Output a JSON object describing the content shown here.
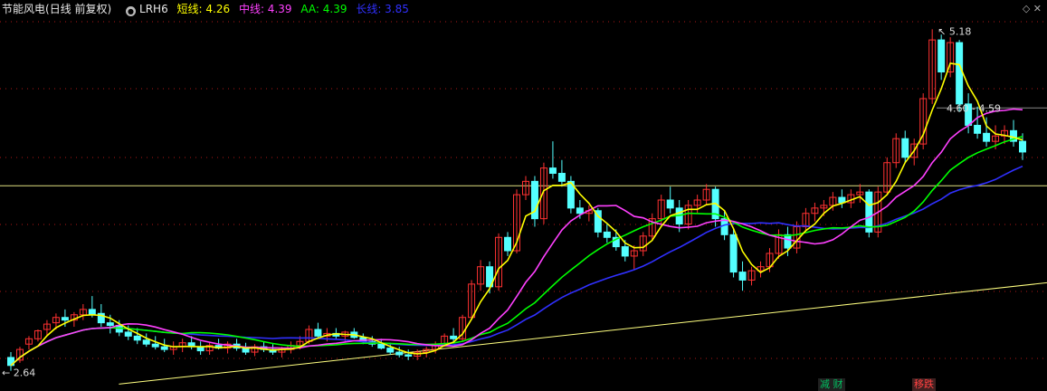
{
  "header": {
    "stock_name": "节能风电",
    "period_label": "(日线 前复权)",
    "indicator_name": "LRH6",
    "indicators": [
      {
        "label": "短线: 4.26",
        "color": "#ffff00"
      },
      {
        "label": "中线: 4.39",
        "color": "#ff40ff"
      },
      {
        "label": "AA: 4.39",
        "color": "#00ff00"
      },
      {
        "label": "长线: 3.85",
        "color": "#3030ff"
      }
    ],
    "corner_icons": [
      "diamond-icon",
      "close-icon"
    ]
  },
  "annotations": {
    "high_label": "5.18",
    "low_label": "2.64",
    "line_label": "4.60 - 4.59"
  },
  "signals": [
    {
      "label": "减 财",
      "color": "#00c060"
    },
    {
      "label": "移跌",
      "color": "#ff4040"
    }
  ],
  "chart_data": {
    "type": "candlestick",
    "ylim": [
      2.55,
      5.25
    ],
    "n_bars": 113,
    "colors": {
      "up": "#ff3232",
      "down": "#54ffff",
      "ma_short": "#ffff00",
      "ma_mid": "#ff40ff",
      "aa": "#00ff00",
      "ma_long": "#3030ff",
      "ref_line": "#ffff80",
      "grid": "#b01818"
    },
    "candles": [
      [
        2.72,
        2.76,
        2.62,
        2.66
      ],
      [
        2.7,
        2.8,
        2.68,
        2.78
      ],
      [
        2.82,
        2.88,
        2.78,
        2.86
      ],
      [
        2.86,
        2.93,
        2.84,
        2.92
      ],
      [
        2.93,
        3.0,
        2.88,
        2.97
      ],
      [
        2.98,
        3.05,
        2.93,
        3.02
      ],
      [
        3.02,
        3.08,
        2.95,
        3.0
      ],
      [
        3.0,
        3.06,
        2.95,
        3.04
      ],
      [
        3.04,
        3.12,
        3.0,
        3.08
      ],
      [
        3.08,
        3.18,
        3.02,
        3.04
      ],
      [
        3.05,
        3.12,
        2.95,
        2.98
      ],
      [
        2.98,
        3.04,
        2.9,
        2.96
      ],
      [
        2.96,
        3.0,
        2.88,
        2.91
      ],
      [
        2.91,
        2.96,
        2.85,
        2.88
      ],
      [
        2.88,
        2.94,
        2.82,
        2.85
      ],
      [
        2.85,
        2.9,
        2.8,
        2.82
      ],
      [
        2.82,
        2.88,
        2.78,
        2.8
      ],
      [
        2.8,
        2.86,
        2.76,
        2.78
      ],
      [
        2.78,
        2.84,
        2.74,
        2.8
      ],
      [
        2.8,
        2.86,
        2.76,
        2.83
      ],
      [
        2.83,
        2.88,
        2.78,
        2.8
      ],
      [
        2.8,
        2.84,
        2.74,
        2.77
      ],
      [
        2.77,
        2.83,
        2.74,
        2.81
      ],
      [
        2.81,
        2.86,
        2.78,
        2.79
      ],
      [
        2.79,
        2.84,
        2.75,
        2.82
      ],
      [
        2.82,
        2.86,
        2.77,
        2.79
      ],
      [
        2.79,
        2.83,
        2.74,
        2.76
      ],
      [
        2.76,
        2.82,
        2.73,
        2.8
      ],
      [
        2.8,
        2.84,
        2.76,
        2.78
      ],
      [
        2.78,
        2.82,
        2.74,
        2.76
      ],
      [
        2.76,
        2.8,
        2.72,
        2.78
      ],
      [
        2.78,
        2.84,
        2.75,
        2.81
      ],
      [
        2.81,
        2.88,
        2.78,
        2.84
      ],
      [
        2.84,
        2.96,
        2.82,
        2.93
      ],
      [
        2.93,
        2.98,
        2.86,
        2.88
      ],
      [
        2.88,
        2.94,
        2.84,
        2.9
      ],
      [
        2.9,
        2.94,
        2.86,
        2.88
      ],
      [
        2.88,
        2.92,
        2.84,
        2.91
      ],
      [
        2.91,
        2.94,
        2.86,
        2.87
      ],
      [
        2.87,
        2.9,
        2.82,
        2.84
      ],
      [
        2.84,
        2.88,
        2.8,
        2.82
      ],
      [
        2.82,
        2.86,
        2.78,
        2.79
      ],
      [
        2.79,
        2.83,
        2.74,
        2.76
      ],
      [
        2.76,
        2.8,
        2.72,
        2.74
      ],
      [
        2.74,
        2.78,
        2.7,
        2.73
      ],
      [
        2.73,
        2.78,
        2.7,
        2.76
      ],
      [
        2.76,
        2.8,
        2.72,
        2.78
      ],
      [
        2.78,
        2.84,
        2.75,
        2.82
      ],
      [
        2.82,
        2.9,
        2.8,
        2.88
      ],
      [
        2.88,
        2.94,
        2.84,
        2.86
      ],
      [
        2.86,
        3.04,
        2.84,
        3.02
      ],
      [
        3.02,
        3.3,
        3.0,
        3.27
      ],
      [
        3.27,
        3.45,
        3.22,
        3.4
      ],
      [
        3.4,
        3.44,
        3.2,
        3.25
      ],
      [
        3.25,
        3.65,
        3.22,
        3.62
      ],
      [
        3.62,
        3.66,
        3.48,
        3.52
      ],
      [
        3.52,
        3.98,
        3.5,
        3.94
      ],
      [
        3.94,
        4.08,
        3.9,
        4.04
      ],
      [
        4.04,
        4.08,
        3.7,
        3.76
      ],
      [
        3.76,
        4.18,
        3.72,
        4.14
      ],
      [
        4.14,
        4.34,
        4.06,
        4.1
      ],
      [
        4.1,
        4.2,
        4.0,
        4.04
      ],
      [
        4.04,
        4.08,
        3.8,
        3.84
      ],
      [
        3.84,
        3.9,
        3.76,
        3.8
      ],
      [
        3.8,
        3.86,
        3.74,
        3.82
      ],
      [
        3.82,
        3.84,
        3.62,
        3.66
      ],
      [
        3.66,
        3.72,
        3.58,
        3.62
      ],
      [
        3.62,
        3.68,
        3.52,
        3.55
      ],
      [
        3.55,
        3.6,
        3.44,
        3.48
      ],
      [
        3.48,
        3.56,
        3.38,
        3.52
      ],
      [
        3.52,
        3.66,
        3.48,
        3.63
      ],
      [
        3.63,
        3.8,
        3.6,
        3.76
      ],
      [
        3.76,
        3.94,
        3.72,
        3.9
      ],
      [
        3.9,
        4.0,
        3.8,
        3.84
      ],
      [
        3.84,
        3.9,
        3.66,
        3.72
      ],
      [
        3.72,
        3.9,
        3.68,
        3.86
      ],
      [
        3.86,
        3.94,
        3.8,
        3.9
      ],
      [
        3.9,
        4.02,
        3.86,
        3.98
      ],
      [
        3.98,
        4.0,
        3.7,
        3.76
      ],
      [
        3.76,
        3.82,
        3.6,
        3.64
      ],
      [
        3.64,
        3.68,
        3.32,
        3.36
      ],
      [
        3.36,
        3.44,
        3.22,
        3.3
      ],
      [
        3.3,
        3.4,
        3.26,
        3.37
      ],
      [
        3.37,
        3.44,
        3.32,
        3.4
      ],
      [
        3.4,
        3.54,
        3.36,
        3.5
      ],
      [
        3.5,
        3.68,
        3.46,
        3.64
      ],
      [
        3.64,
        3.7,
        3.48,
        3.54
      ],
      [
        3.54,
        3.74,
        3.5,
        3.7
      ],
      [
        3.7,
        3.84,
        3.66,
        3.8
      ],
      [
        3.8,
        3.88,
        3.74,
        3.84
      ],
      [
        3.84,
        3.9,
        3.78,
        3.86
      ],
      [
        3.86,
        3.96,
        3.82,
        3.92
      ],
      [
        3.92,
        3.98,
        3.84,
        3.88
      ],
      [
        3.88,
        3.98,
        3.84,
        3.94
      ],
      [
        3.94,
        4.02,
        3.88,
        3.96
      ],
      [
        3.96,
        3.98,
        3.62,
        3.66
      ],
      [
        3.66,
        4.0,
        3.62,
        3.96
      ],
      [
        3.96,
        4.22,
        3.94,
        4.18
      ],
      [
        4.18,
        4.4,
        4.14,
        4.36
      ],
      [
        4.36,
        4.42,
        4.18,
        4.22
      ],
      [
        4.22,
        4.36,
        4.16,
        4.32
      ],
      [
        4.32,
        4.7,
        4.28,
        4.66
      ],
      [
        4.66,
        5.18,
        4.62,
        5.1
      ],
      [
        5.1,
        5.14,
        4.8,
        4.86
      ],
      [
        4.86,
        5.12,
        4.82,
        5.08
      ],
      [
        5.08,
        5.1,
        4.56,
        4.62
      ],
      [
        4.62,
        4.7,
        4.4,
        4.46
      ],
      [
        4.46,
        4.6,
        4.36,
        4.4
      ],
      [
        4.4,
        4.52,
        4.3,
        4.34
      ],
      [
        4.34,
        4.46,
        4.28,
        4.38
      ],
      [
        4.38,
        4.46,
        4.32,
        4.42
      ],
      [
        4.42,
        4.5,
        4.3,
        4.34
      ],
      [
        4.34,
        4.4,
        4.2,
        4.26
      ]
    ],
    "ref_lines": [
      {
        "from": [
          35,
          2.52
        ],
        "to": [
          169,
          3.28
        ],
        "color": "#ffff80"
      }
    ],
    "hline_value": 4.59,
    "hline_label_value": "4.60 - 4.59"
  }
}
